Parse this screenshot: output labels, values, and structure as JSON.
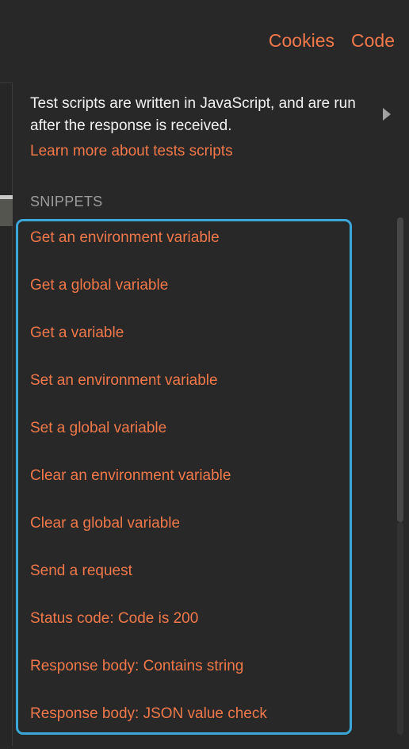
{
  "header": {
    "links": [
      {
        "label": "Cookies"
      },
      {
        "label": "Code"
      }
    ]
  },
  "tests": {
    "description": "Test scripts are written in JavaScript, and are run after the response is received.",
    "learn_more": "Learn more about tests scripts"
  },
  "snippets": {
    "heading": "SNIPPETS",
    "items": [
      {
        "label": "Get an environment variable"
      },
      {
        "label": "Get a global variable"
      },
      {
        "label": "Get a variable"
      },
      {
        "label": "Set an environment variable"
      },
      {
        "label": "Set a global variable"
      },
      {
        "label": "Clear an environment variable"
      },
      {
        "label": "Clear a global variable"
      },
      {
        "label": "Send a request"
      },
      {
        "label": "Status code: Code is 200"
      },
      {
        "label": "Response body: Contains string"
      },
      {
        "label": "Response body: JSON value check"
      }
    ]
  },
  "colors": {
    "background": "#282828",
    "accent": "#f0784a",
    "highlight_border": "#3aa7d8",
    "text": "#f2f2f2",
    "muted": "#9c9c9c"
  },
  "icons": {
    "expand": "chevron-right-icon"
  }
}
